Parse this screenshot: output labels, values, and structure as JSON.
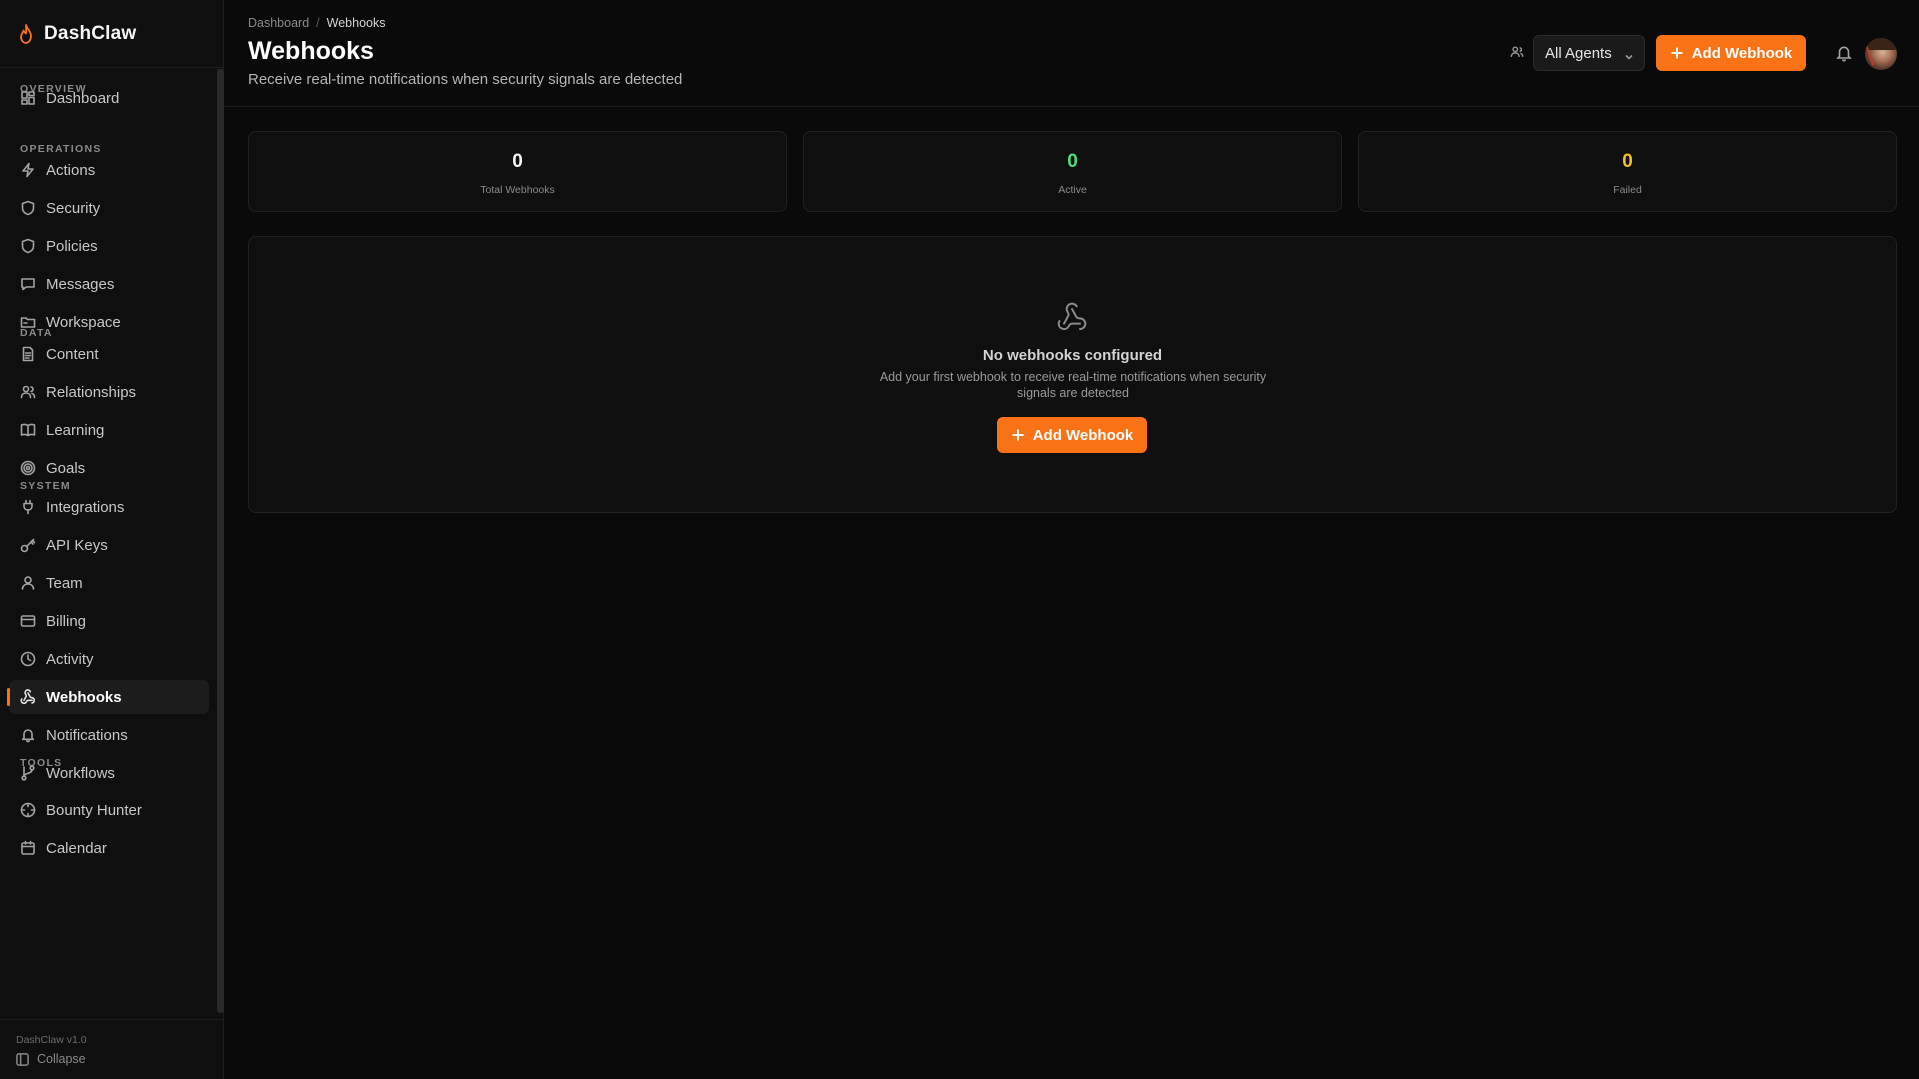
{
  "app": {
    "name": "DashClaw",
    "version": "DashClaw v1.0",
    "collapse_label": "Collapse"
  },
  "colors": {
    "accent": "#f97316",
    "active_green": "#4ade80",
    "failed_amber": "#fbbf24",
    "background": "#0a0a0a"
  },
  "sidebar": {
    "sections": {
      "overview": "OVERVIEW",
      "operations": "OPERATIONS",
      "data": "DATA",
      "system": "SYSTEM",
      "tools": "TOOLS"
    },
    "items": [
      {
        "label": "Dashboard",
        "icon": "dashboard-icon"
      },
      {
        "label": "Actions",
        "icon": "lightning-icon"
      },
      {
        "label": "Security",
        "icon": "shield-icon"
      },
      {
        "label": "Policies",
        "icon": "shield-icon"
      },
      {
        "label": "Messages",
        "icon": "message-icon"
      },
      {
        "label": "Workspace",
        "icon": "folder-icon"
      },
      {
        "label": "Content",
        "icon": "document-icon"
      },
      {
        "label": "Relationships",
        "icon": "users-icon"
      },
      {
        "label": "Learning",
        "icon": "book-icon"
      },
      {
        "label": "Goals",
        "icon": "target-icon"
      },
      {
        "label": "Integrations",
        "icon": "plug-icon"
      },
      {
        "label": "API Keys",
        "icon": "key-icon"
      },
      {
        "label": "Team",
        "icon": "user-icon"
      },
      {
        "label": "Billing",
        "icon": "credit-card-icon"
      },
      {
        "label": "Activity",
        "icon": "clock-icon"
      },
      {
        "label": "Webhooks",
        "icon": "webhook-icon",
        "active": true
      },
      {
        "label": "Notifications",
        "icon": "bell-icon"
      },
      {
        "label": "Workflows",
        "icon": "branch-icon"
      },
      {
        "label": "Bounty Hunter",
        "icon": "crosshair-icon"
      },
      {
        "label": "Calendar",
        "icon": "calendar-icon"
      }
    ]
  },
  "header": {
    "breadcrumb": [
      "Dashboard",
      "Webhooks"
    ],
    "breadcrumb_separator": "/",
    "title": "Webhooks",
    "subtitle": "Receive real-time notifications when security signals are detected",
    "agent_filter": "All Agents",
    "add_button": "Add Webhook"
  },
  "stats": [
    {
      "value": "0",
      "label": "Total Webhooks",
      "color": "#f5f5f5"
    },
    {
      "value": "0",
      "label": "Active",
      "color": "#4ade80"
    },
    {
      "value": "0",
      "label": "Failed",
      "color": "#fbbf24"
    }
  ],
  "empty_state": {
    "title": "No webhooks configured",
    "description": "Add your first webhook to receive real-time notifications when security signals are detected",
    "button": "Add Webhook"
  }
}
